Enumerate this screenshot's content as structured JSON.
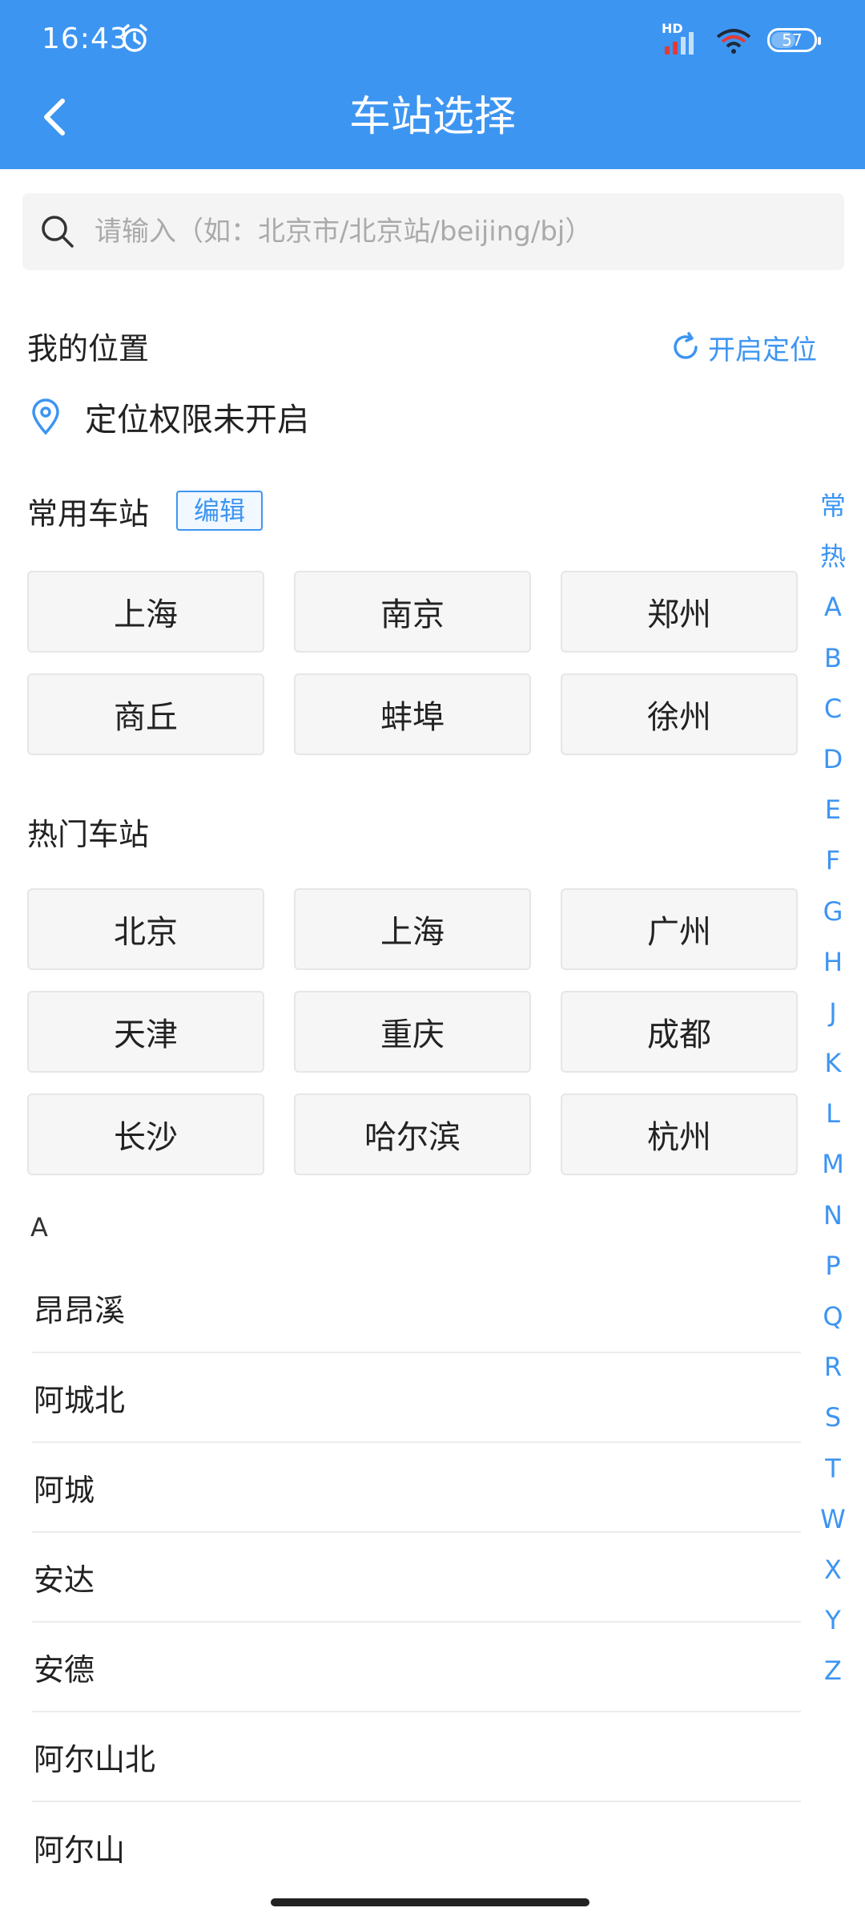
{
  "status_bar": {
    "time": "16:43",
    "battery": "57",
    "network": "HD"
  },
  "header": {
    "title": "车站选择"
  },
  "search": {
    "placeholder": "请输入（如：北京市/北京站/beijing/bj）"
  },
  "location": {
    "title": "我的位置",
    "enable_label": "开启定位",
    "status_text": "定位权限未开启"
  },
  "frequent": {
    "title": "常用车站",
    "edit_label": "编辑",
    "stations": [
      "上海",
      "南京",
      "郑州",
      "商丘",
      "蚌埠",
      "徐州"
    ]
  },
  "hot": {
    "title": "热门车站",
    "stations": [
      "北京",
      "上海",
      "广州",
      "天津",
      "重庆",
      "成都",
      "长沙",
      "哈尔滨",
      "杭州"
    ]
  },
  "list": {
    "letter": "A",
    "items": [
      "昂昂溪",
      "阿城北",
      "阿城",
      "安达",
      "安德",
      "阿尔山北",
      "阿尔山"
    ]
  },
  "alphabet_index": [
    "常",
    "热",
    "A",
    "B",
    "C",
    "D",
    "E",
    "F",
    "G",
    "H",
    "J",
    "K",
    "L",
    "M",
    "N",
    "P",
    "Q",
    "R",
    "S",
    "T",
    "W",
    "X",
    "Y",
    "Z"
  ],
  "colors": {
    "accent": "#3d95f2",
    "header_bg": "#3d95f2"
  }
}
